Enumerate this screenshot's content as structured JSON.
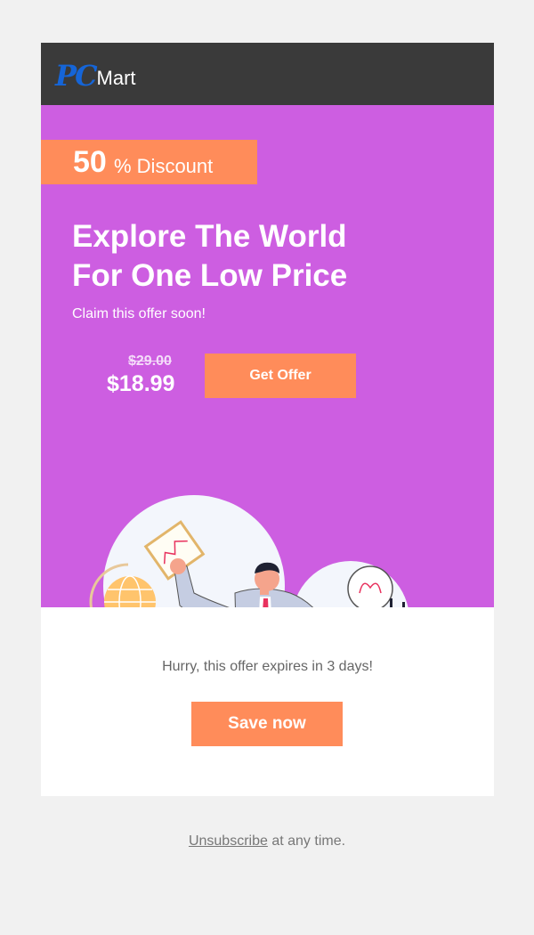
{
  "brand": {
    "logo_pc": "PC",
    "logo_mart": "Mart"
  },
  "colors": {
    "header_bg": "#3a3a3a",
    "hero_bg": "#cd5ee1",
    "accent": "#ff8c5a",
    "page_bg": "#f1f1f1",
    "logo_blue": "#1565d8"
  },
  "hero": {
    "discount_value": "50",
    "discount_text": "% Discount",
    "headline_line1": "Explore The World",
    "headline_line2": "For One Low Price",
    "subtext": "Claim this offer soon!",
    "old_price": "$29.00",
    "new_price": "$18.99",
    "cta_label": "Get Offer",
    "illustration": "man-with-laptop-illustration"
  },
  "promo": {
    "expiry_text": "Hurry, this offer expires in 3 days!",
    "cta_label": "Save now"
  },
  "footer": {
    "unsubscribe_link": "Unsubscribe",
    "suffix_text": " at any time."
  }
}
